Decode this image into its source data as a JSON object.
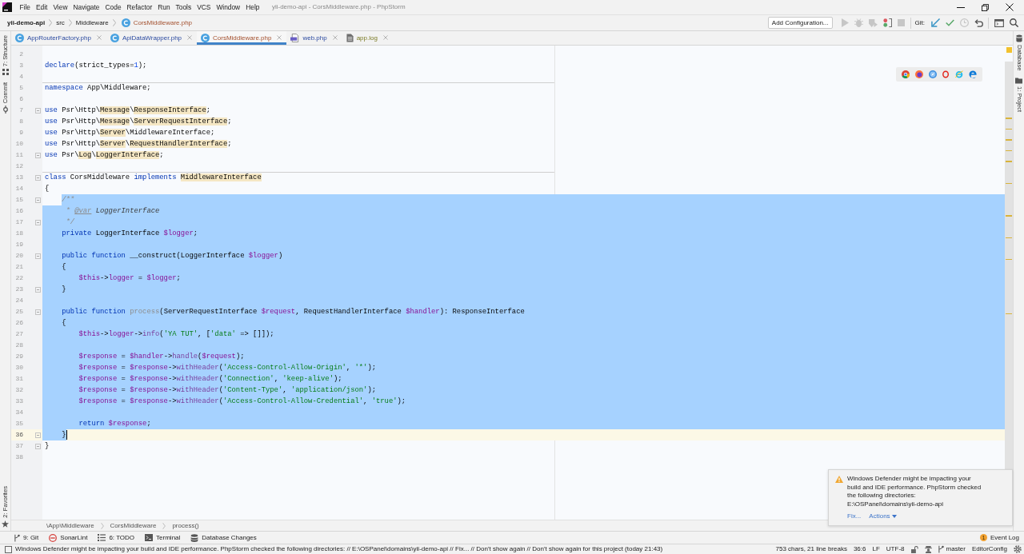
{
  "window": {
    "title": "yii-demo-api - CorsMiddleware.php - PhpStorm"
  },
  "menu": [
    "File",
    "Edit",
    "View",
    "Navigate",
    "Code",
    "Refactor",
    "Run",
    "Tools",
    "VCS",
    "Window",
    "Help"
  ],
  "navigation": {
    "crumbs": [
      {
        "label": "yii-demo-api",
        "kind": "project",
        "unversioned": false
      },
      {
        "label": "src",
        "kind": "folder",
        "unversioned": false
      },
      {
        "label": "Middleware",
        "kind": "folder",
        "unversioned": false
      },
      {
        "label": "CorsMiddleware.php",
        "kind": "class_file",
        "unversioned": true
      }
    ],
    "run_config": "Add Configuration...",
    "run_actions": [
      {
        "kind": "run",
        "disabled": true
      },
      {
        "kind": "debug",
        "disabled": true
      },
      {
        "kind": "coverage",
        "disabled": true
      },
      {
        "kind": "listener",
        "disabled": false
      },
      {
        "kind": "stop",
        "disabled": true
      }
    ],
    "vcs_label": "Git:",
    "vcs_actions": [
      {
        "kind": "update",
        "disabled": false
      },
      {
        "kind": "commit",
        "disabled": false
      },
      {
        "kind": "history",
        "disabled": true
      },
      {
        "kind": "rollback",
        "disabled": false
      }
    ],
    "tools": [
      {
        "kind": "terminal"
      },
      {
        "kind": "search"
      }
    ]
  },
  "tool_stripes": {
    "left": [
      {
        "label": "7: Structure",
        "kind": "structure"
      },
      {
        "label": "Commit",
        "kind": "commit"
      }
    ],
    "left_bottom": [
      {
        "label": "2: Favorites",
        "kind": "favorites"
      }
    ],
    "right": [
      {
        "label": "Database",
        "kind": "database"
      },
      {
        "label": "1: Project",
        "kind": "project"
      }
    ]
  },
  "tabs": [
    {
      "label": "AppRouterFactory.php",
      "kind": "class",
      "selected": false,
      "modified": true,
      "unversioned": false,
      "ignored": false
    },
    {
      "label": "ApiDataWrapper.php",
      "kind": "class",
      "selected": false,
      "modified": true,
      "unversioned": false,
      "ignored": false
    },
    {
      "label": "CorsMiddleware.php",
      "kind": "class",
      "selected": true,
      "modified": false,
      "unversioned": true,
      "ignored": false
    },
    {
      "label": "web.php",
      "kind": "php",
      "selected": false,
      "modified": true,
      "unversioned": false,
      "ignored": false
    },
    {
      "label": "app.log",
      "kind": "text",
      "selected": false,
      "modified": false,
      "unversioned": false,
      "ignored": true
    }
  ],
  "editor": {
    "lines": [
      {
        "number": "2",
        "selected": false,
        "current": false,
        "separator": false,
        "fold": false
      },
      {
        "number": "3",
        "tokens": [
          {
            "text": "declare",
            "kind": "keyword"
          },
          {
            "text": "(strict_types=",
            "kind": "plain"
          },
          {
            "text": "1",
            "kind": "number"
          },
          {
            "text": ");",
            "kind": "plain"
          }
        ],
        "selected": false,
        "current": false,
        "separator": false,
        "fold": false
      },
      {
        "number": "4",
        "selected": false,
        "current": false,
        "separator": false,
        "fold": false
      },
      {
        "number": "5",
        "tokens": [
          {
            "text": "namespace",
            "kind": "keyword"
          },
          {
            "text": " App\\Middleware;",
            "kind": "plain"
          }
        ],
        "selected": false,
        "current": false,
        "separator": true,
        "fold": false
      },
      {
        "number": "6",
        "selected": false,
        "current": false,
        "separator": false,
        "fold": false
      },
      {
        "number": "7",
        "tokens": [
          {
            "text": "use",
            "kind": "keyword"
          },
          {
            "text": " Psr\\Http\\",
            "kind": "plain"
          },
          {
            "text": "Message",
            "kind": "usage"
          },
          {
            "text": "\\",
            "kind": "plain"
          },
          {
            "text": "ResponseInterface",
            "kind": "usage"
          },
          {
            "text": ";",
            "kind": "plain"
          }
        ],
        "selected": false,
        "current": false,
        "separator": false,
        "fold": true
      },
      {
        "number": "8",
        "tokens": [
          {
            "text": "use",
            "kind": "keyword"
          },
          {
            "text": " Psr\\Http\\",
            "kind": "plain"
          },
          {
            "text": "Message",
            "kind": "usage"
          },
          {
            "text": "\\",
            "kind": "plain"
          },
          {
            "text": "ServerRequestInterface",
            "kind": "usage"
          },
          {
            "text": ";",
            "kind": "plain"
          }
        ],
        "selected": false,
        "current": false,
        "separator": false,
        "fold": false
      },
      {
        "number": "9",
        "tokens": [
          {
            "text": "use",
            "kind": "keyword"
          },
          {
            "text": " Psr\\Http\\",
            "kind": "plain"
          },
          {
            "text": "Server",
            "kind": "usage"
          },
          {
            "text": "\\MiddlewareInterface;",
            "kind": "plain"
          }
        ],
        "selected": false,
        "current": false,
        "separator": false,
        "fold": false
      },
      {
        "number": "10",
        "tokens": [
          {
            "text": "use",
            "kind": "keyword"
          },
          {
            "text": " Psr\\Http\\",
            "kind": "plain"
          },
          {
            "text": "Server",
            "kind": "usage"
          },
          {
            "text": "\\",
            "kind": "plain"
          },
          {
            "text": "RequestHandlerInterface",
            "kind": "usage"
          },
          {
            "text": ";",
            "kind": "plain"
          }
        ],
        "selected": false,
        "current": false,
        "separator": false,
        "fold": false
      },
      {
        "number": "11",
        "tokens": [
          {
            "text": "use",
            "kind": "keyword"
          },
          {
            "text": " Psr\\",
            "kind": "plain"
          },
          {
            "text": "Log",
            "kind": "usage"
          },
          {
            "text": "\\",
            "kind": "plain"
          },
          {
            "text": "LoggerInterface",
            "kind": "usage"
          },
          {
            "text": ";",
            "kind": "plain"
          }
        ],
        "selected": false,
        "current": false,
        "separator": false,
        "fold": true
      },
      {
        "number": "12",
        "selected": false,
        "current": false,
        "separator": false,
        "fold": false
      },
      {
        "number": "13",
        "tokens": [
          {
            "text": "class",
            "kind": "keyword"
          },
          {
            "text": " CorsMiddleware ",
            "kind": "plain"
          },
          {
            "text": "implements ",
            "kind": "keyword"
          },
          {
            "text": "MiddlewareInterface",
            "kind": "usage"
          }
        ],
        "selected": false,
        "current": false,
        "separator": true,
        "fold": true
      },
      {
        "number": "14",
        "tokens": [
          {
            "text": "{",
            "kind": "plain"
          }
        ],
        "selected": false,
        "current": false,
        "separator": false,
        "fold": false
      },
      {
        "number": "15",
        "tokens": [
          {
            "text": "    /**",
            "kind": "comment"
          }
        ],
        "selected": true,
        "current": false,
        "separator": false,
        "fold": true
      },
      {
        "number": "16",
        "tokens": [
          {
            "text": "     * ",
            "kind": "comment"
          },
          {
            "text": "@var",
            "kind": "doc_tag"
          },
          {
            "text": " LoggerInterface",
            "kind": "doc_usage"
          }
        ],
        "selected": true,
        "current": false,
        "separator": false,
        "fold": false
      },
      {
        "number": "17",
        "tokens": [
          {
            "text": "     */",
            "kind": "comment"
          }
        ],
        "selected": true,
        "current": false,
        "separator": false,
        "fold": true
      },
      {
        "number": "18",
        "tokens": [
          {
            "text": "    private ",
            "kind": "keyword"
          },
          {
            "text": "LoggerInterface",
            "kind": "usage"
          },
          {
            "text": " $logger",
            "kind": "var"
          },
          {
            "text": ";",
            "kind": "plain"
          }
        ],
        "selected": true,
        "current": false,
        "separator": false,
        "fold": false
      },
      {
        "number": "19",
        "selected": true,
        "current": false,
        "separator": false,
        "fold": false
      },
      {
        "number": "20",
        "tokens": [
          {
            "text": "    public function",
            "kind": "keyword"
          },
          {
            "text": " __construct(",
            "kind": "plain"
          },
          {
            "text": "LoggerInterface",
            "kind": "usage"
          },
          {
            "text": " $logger",
            "kind": "var"
          },
          {
            "text": ")",
            "kind": "plain"
          }
        ],
        "selected": true,
        "current": false,
        "separator": false,
        "fold": true
      },
      {
        "number": "21",
        "tokens": [
          {
            "text": "    {",
            "kind": "plain"
          }
        ],
        "selected": true,
        "current": false,
        "separator": false,
        "fold": false
      },
      {
        "number": "22",
        "tokens": [
          {
            "text": "        $this",
            "kind": "var"
          },
          {
            "text": "->",
            "kind": "plain"
          },
          {
            "text": "logger",
            "kind": "field"
          },
          {
            "text": " = ",
            "kind": "plain"
          },
          {
            "text": "$logger",
            "kind": "var"
          },
          {
            "text": ";",
            "kind": "plain"
          }
        ],
        "selected": true,
        "current": false,
        "separator": false,
        "fold": false
      },
      {
        "number": "23",
        "tokens": [
          {
            "text": "    }",
            "kind": "plain"
          }
        ],
        "selected": true,
        "current": false,
        "separator": false,
        "fold": true
      },
      {
        "number": "24",
        "selected": true,
        "current": false,
        "separator": false,
        "fold": false
      },
      {
        "number": "25",
        "tokens": [
          {
            "text": "    public function ",
            "kind": "keyword"
          },
          {
            "text": "process",
            "kind": "unused"
          },
          {
            "text": "(",
            "kind": "plain"
          },
          {
            "text": "ServerRequestInterface",
            "kind": "usage"
          },
          {
            "text": " $request",
            "kind": "var"
          },
          {
            "text": ", ",
            "kind": "plain"
          },
          {
            "text": "RequestHandlerInterface",
            "kind": "usage"
          },
          {
            "text": " $handler",
            "kind": "var"
          },
          {
            "text": "): ",
            "kind": "plain"
          },
          {
            "text": "ResponseInterface",
            "kind": "usage"
          }
        ],
        "selected": true,
        "current": false,
        "separator": false,
        "fold": true
      },
      {
        "number": "26",
        "tokens": [
          {
            "text": "    {",
            "kind": "plain"
          }
        ],
        "selected": true,
        "current": false,
        "separator": false,
        "fold": false
      },
      {
        "number": "27",
        "tokens": [
          {
            "text": "        $this",
            "kind": "var"
          },
          {
            "text": "->",
            "kind": "plain"
          },
          {
            "text": "logger",
            "kind": "field"
          },
          {
            "text": "->",
            "kind": "plain"
          },
          {
            "text": "info",
            "kind": "call"
          },
          {
            "text": "(",
            "kind": "plain"
          },
          {
            "text": "'YA TUT'",
            "kind": "string"
          },
          {
            "text": ", [",
            "kind": "plain"
          },
          {
            "text": "'data'",
            "kind": "string"
          },
          {
            "text": " => []]);",
            "kind": "plain"
          }
        ],
        "selected": true,
        "current": false,
        "separator": false,
        "fold": false
      },
      {
        "number": "28",
        "selected": true,
        "current": false,
        "separator": false,
        "fold": false
      },
      {
        "number": "29",
        "tokens": [
          {
            "text": "        $response",
            "kind": "var"
          },
          {
            "text": " = ",
            "kind": "plain"
          },
          {
            "text": "$handler",
            "kind": "var"
          },
          {
            "text": "->",
            "kind": "plain"
          },
          {
            "text": "handle",
            "kind": "call"
          },
          {
            "text": "(",
            "kind": "plain"
          },
          {
            "text": "$request",
            "kind": "var"
          },
          {
            "text": ");",
            "kind": "plain"
          }
        ],
        "selected": true,
        "current": false,
        "separator": false,
        "fold": false
      },
      {
        "number": "30",
        "tokens": [
          {
            "text": "        $response",
            "kind": "var"
          },
          {
            "text": " = ",
            "kind": "plain"
          },
          {
            "text": "$response",
            "kind": "var"
          },
          {
            "text": "->",
            "kind": "plain"
          },
          {
            "text": "withHeader",
            "kind": "call"
          },
          {
            "text": "(",
            "kind": "plain"
          },
          {
            "text": "'Access-Control-Allow-Origin'",
            "kind": "string"
          },
          {
            "text": ", ",
            "kind": "plain"
          },
          {
            "text": "'*'",
            "kind": "string"
          },
          {
            "text": ");",
            "kind": "plain"
          }
        ],
        "selected": true,
        "current": false,
        "separator": false,
        "fold": false
      },
      {
        "number": "31",
        "tokens": [
          {
            "text": "        $response",
            "kind": "var"
          },
          {
            "text": " = ",
            "kind": "plain"
          },
          {
            "text": "$response",
            "kind": "var"
          },
          {
            "text": "->",
            "kind": "plain"
          },
          {
            "text": "withHeader",
            "kind": "call"
          },
          {
            "text": "(",
            "kind": "plain"
          },
          {
            "text": "'Connection'",
            "kind": "string"
          },
          {
            "text": ", ",
            "kind": "plain"
          },
          {
            "text": "'keep-alive'",
            "kind": "string"
          },
          {
            "text": ");",
            "kind": "plain"
          }
        ],
        "selected": true,
        "current": false,
        "separator": false,
        "fold": false
      },
      {
        "number": "32",
        "tokens": [
          {
            "text": "        $response",
            "kind": "var"
          },
          {
            "text": " = ",
            "kind": "plain"
          },
          {
            "text": "$response",
            "kind": "var"
          },
          {
            "text": "->",
            "kind": "plain"
          },
          {
            "text": "withHeader",
            "kind": "call"
          },
          {
            "text": "(",
            "kind": "plain"
          },
          {
            "text": "'Content-Type'",
            "kind": "string"
          },
          {
            "text": ", ",
            "kind": "plain"
          },
          {
            "text": "'application/json'",
            "kind": "string"
          },
          {
            "text": ");",
            "kind": "plain"
          }
        ],
        "selected": true,
        "current": false,
        "separator": false,
        "fold": false
      },
      {
        "number": "33",
        "tokens": [
          {
            "text": "        $response",
            "kind": "var"
          },
          {
            "text": " = ",
            "kind": "plain"
          },
          {
            "text": "$response",
            "kind": "var"
          },
          {
            "text": "->",
            "kind": "plain"
          },
          {
            "text": "withHeader",
            "kind": "call"
          },
          {
            "text": "(",
            "kind": "plain"
          },
          {
            "text": "'Access-Control-Allow-Credential'",
            "kind": "string"
          },
          {
            "text": ", ",
            "kind": "plain"
          },
          {
            "text": "'true'",
            "kind": "string"
          },
          {
            "text": ");",
            "kind": "plain"
          }
        ],
        "selected": true,
        "current": false,
        "separator": false,
        "fold": false
      },
      {
        "number": "34",
        "selected": true,
        "current": false,
        "separator": false,
        "fold": false
      },
      {
        "number": "35",
        "tokens": [
          {
            "text": "        return",
            "kind": "keyword"
          },
          {
            "text": " $response",
            "kind": "var"
          },
          {
            "text": ";",
            "kind": "plain"
          }
        ],
        "selected": true,
        "current": false,
        "separator": false,
        "fold": false
      },
      {
        "number": "36",
        "tokens": [
          {
            "text": "    }",
            "kind": "plain"
          }
        ],
        "selected": true,
        "current": true,
        "separator": false,
        "fold": true
      },
      {
        "number": "37",
        "tokens": [
          {
            "text": "}",
            "kind": "plain"
          }
        ],
        "selected": false,
        "current": false,
        "separator": false,
        "fold": true
      },
      {
        "number": "38",
        "selected": false,
        "current": false,
        "separator": false,
        "fold": false
      }
    ],
    "breadcrumb": [
      "\\App\\Middleware",
      "CorsMiddleware",
      "process()"
    ]
  },
  "browser_popup": {
    "browsers": [
      {
        "kind": "chrome"
      },
      {
        "kind": "firefox"
      },
      {
        "kind": "safari"
      },
      {
        "kind": "opera"
      },
      {
        "kind": "ie"
      },
      {
        "kind": "edge"
      }
    ]
  },
  "notification": {
    "message": "Windows Defender might be impacting your build and IDE performance. PhpStorm checked the following directories:",
    "path": "E:\\OSPanel\\domains\\yii-demo-api",
    "actions": [
      {
        "label": "Fix...",
        "kind": "link"
      },
      {
        "label": "Actions",
        "kind": "menu"
      }
    ]
  },
  "tool_windows": [
    {
      "label": "9: Git",
      "kind": "git"
    },
    {
      "label": "SonarLint",
      "kind": "sonarlint"
    },
    {
      "label": "6: TODO",
      "kind": "todo"
    },
    {
      "label": "Terminal",
      "kind": "terminal"
    },
    {
      "label": "Database Changes",
      "kind": "database"
    }
  ],
  "event_log": {
    "label": "Event Log",
    "count": "1"
  },
  "status_bar": {
    "message": "Windows Defender might be impacting your build and IDE performance. PhpStorm checked the following directories: // E:\\OSPanel\\domains\\yii-demo-api // Fix... // Don't show again // Don't show again for this project (today 21:43)",
    "items": [
      {
        "kind": "text",
        "label": "753 chars, 21 line breaks"
      },
      {
        "kind": "text",
        "label": "36:6"
      },
      {
        "kind": "text",
        "label": "LF"
      },
      {
        "kind": "text",
        "label": "UTF-8"
      },
      {
        "kind": "lock"
      },
      {
        "kind": "inspector"
      },
      {
        "kind": "branch",
        "label": "master"
      },
      {
        "kind": "text",
        "label": "EditorConfig"
      },
      {
        "kind": "settings"
      }
    ]
  }
}
